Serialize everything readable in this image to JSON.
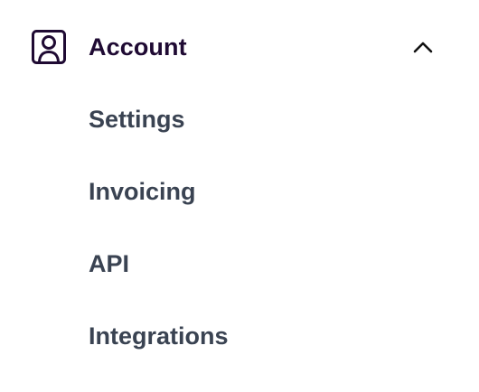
{
  "menu": {
    "title": "Account",
    "icon": "user-square-icon",
    "expanded": true,
    "items": [
      {
        "label": "Settings"
      },
      {
        "label": "Invoicing"
      },
      {
        "label": "API"
      },
      {
        "label": "Integrations"
      }
    ]
  },
  "colors": {
    "title_text": "#1f0a33",
    "item_text": "#3a4352",
    "icon": "#1f0a33",
    "background": "#ffffff"
  }
}
